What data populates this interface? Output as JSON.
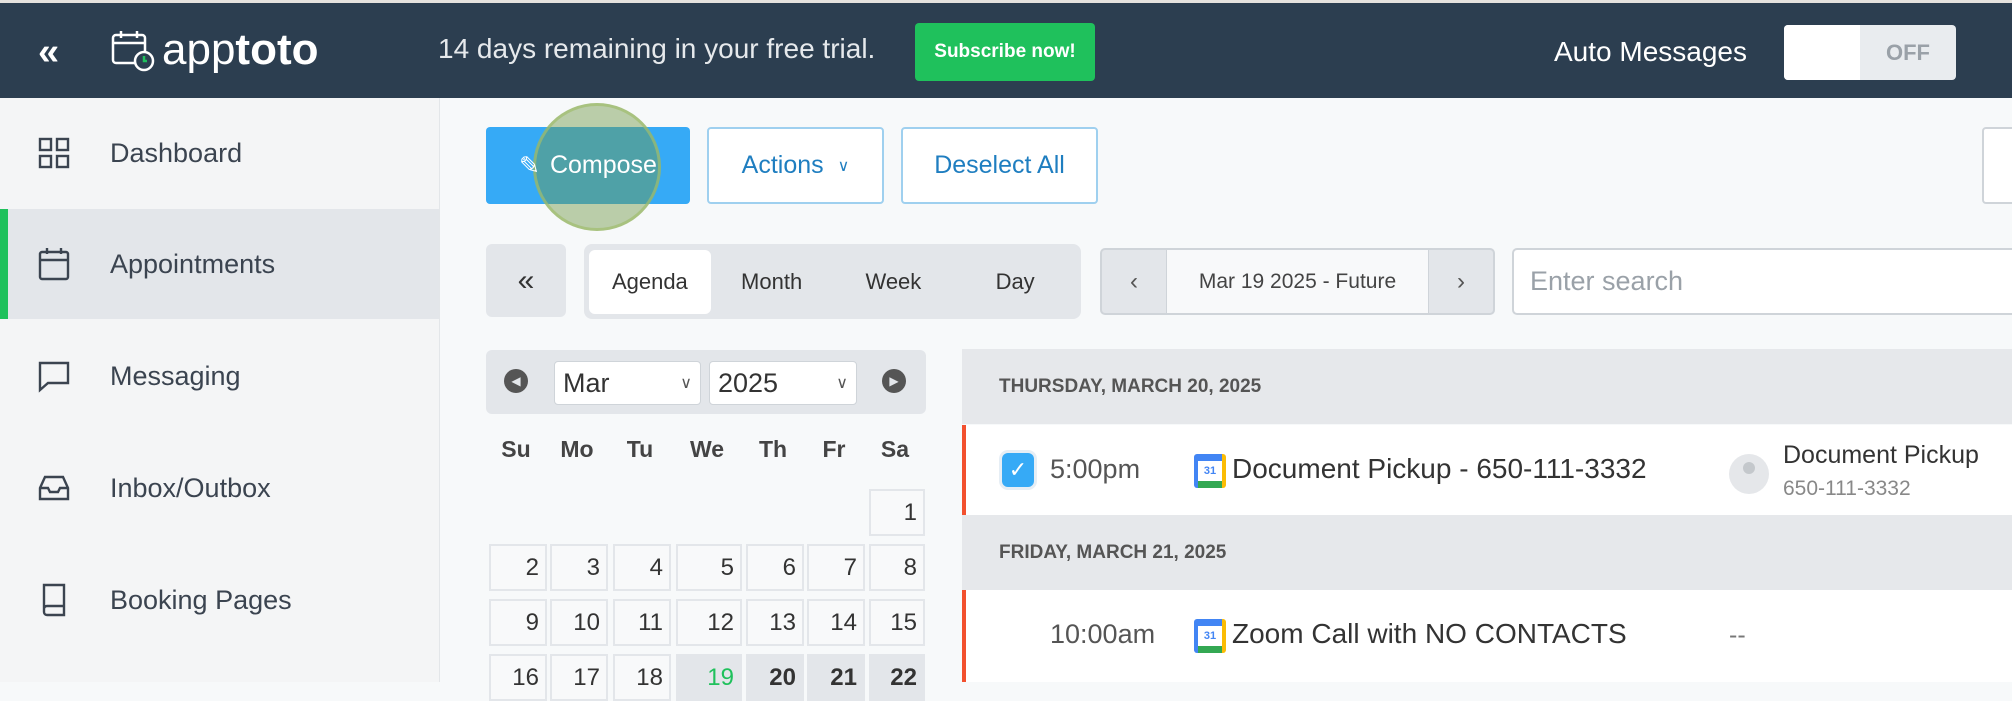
{
  "header": {
    "collapse_icon": "double-chevron-left",
    "brand_prefix": "app",
    "brand_suffix": "toto",
    "trial_text": "14 days remaining in your free trial.",
    "subscribe_label": "Subscribe now!",
    "auto_messages_label": "Auto Messages",
    "toggle_state": "OFF",
    "colors": {
      "bg": "#2c3e50",
      "subscribe": "#1fc15c"
    }
  },
  "sidebar": {
    "items": [
      {
        "label": "Dashboard",
        "icon": "grid-icon"
      },
      {
        "label": "Appointments",
        "icon": "calendar-icon",
        "active": true
      },
      {
        "label": "Messaging",
        "icon": "chat-icon"
      },
      {
        "label": "Inbox/Outbox",
        "icon": "inbox-icon"
      },
      {
        "label": "Booking Pages",
        "icon": "book-icon"
      }
    ]
  },
  "toolbar": {
    "compose_label": "Compose",
    "actions_label": "Actions",
    "deselect_label": "Deselect All"
  },
  "views": {
    "collapse": "«",
    "tabs": [
      "Agenda",
      "Month",
      "Week",
      "Day"
    ],
    "active": "Agenda"
  },
  "date_nav": {
    "prev": "‹",
    "range": "Mar 19 2025 - Future",
    "next": "›"
  },
  "search": {
    "placeholder": "Enter search",
    "value": ""
  },
  "mini_calendar": {
    "month": "Mar",
    "year": "2025",
    "weekdays": [
      "Su",
      "Mo",
      "Tu",
      "We",
      "Th",
      "Fr",
      "Sa"
    ],
    "weeks": [
      [
        "",
        "",
        "",
        "",
        "",
        "",
        "1"
      ],
      [
        "2",
        "3",
        "4",
        "5",
        "6",
        "7",
        "8"
      ],
      [
        "9",
        "10",
        "11",
        "12",
        "13",
        "14",
        "15"
      ],
      [
        "16",
        "17",
        "18",
        "19",
        "20",
        "21",
        "22"
      ]
    ],
    "today": "19"
  },
  "agenda": [
    {
      "date": "THURSDAY, MARCH 20, 2025",
      "events": [
        {
          "checked": true,
          "time": "5:00pm",
          "title": "Document Pickup - 650-111-3332",
          "contact_name": "Document Pickup",
          "contact_phone": "650-111-3332"
        }
      ]
    },
    {
      "date": "FRIDAY, MARCH 21, 2025",
      "events": [
        {
          "checked": false,
          "time": "10:00am",
          "title": "Zoom Call with NO CONTACTS",
          "contact_name": "--"
        }
      ]
    }
  ]
}
